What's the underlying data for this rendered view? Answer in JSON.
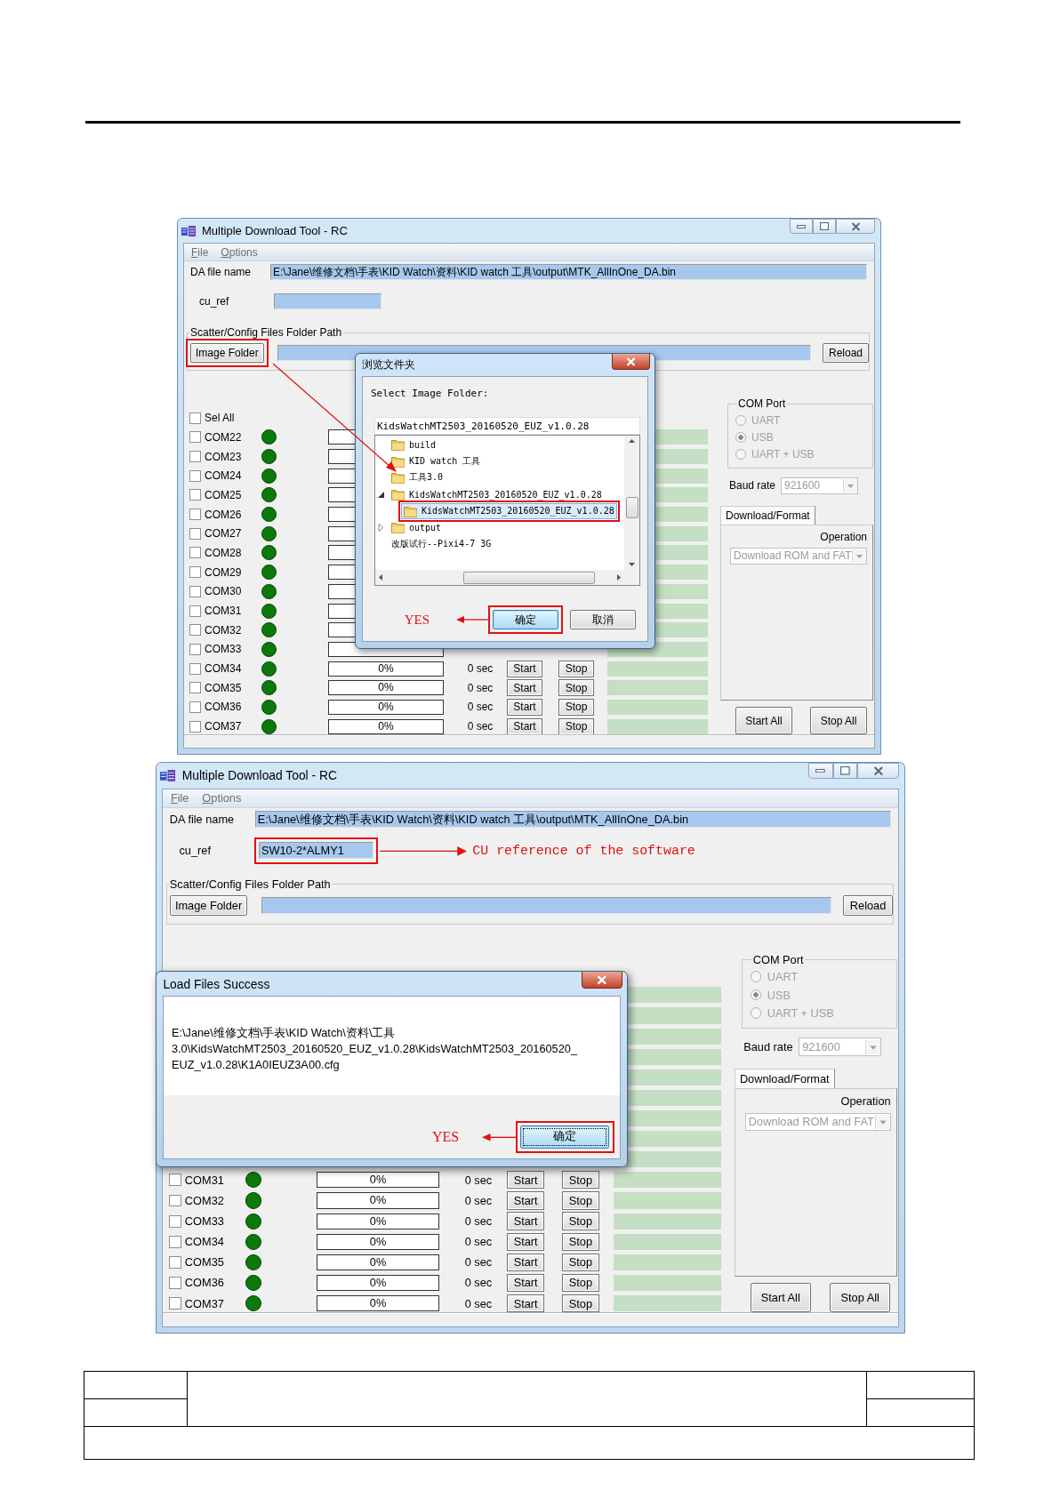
{
  "windows": [
    {
      "title": "Multiple Download Tool - RC",
      "menu": [
        "File",
        "Options"
      ],
      "da_file": {
        "label": "DA file name",
        "value": "E:\\Jane\\维修文档\\手表\\KID Watch\\资料\\KID watch 工具\\output\\MTK_AllInOne_DA.bin"
      },
      "cu_ref": {
        "label": "cu_ref",
        "highlighted": false
      },
      "scatter": {
        "legend": "Scatter/Config Files Folder Path",
        "button": "Image Folder",
        "button_highlighted": true,
        "reload": "Reload"
      },
      "pointer_line": true,
      "sel_all": {
        "label": "Sel All",
        "checked": false
      },
      "rows": [
        {
          "kind": "partial",
          "port": "COM22",
          "checked": false
        },
        {
          "kind": "partial",
          "port": "COM23",
          "checked": false
        },
        {
          "kind": "partial",
          "port": "COM24",
          "checked": false
        },
        {
          "kind": "partial",
          "port": "COM25",
          "checked": false
        },
        {
          "kind": "partial",
          "port": "COM26",
          "checked": false
        },
        {
          "kind": "partial",
          "port": "COM27",
          "checked": false
        },
        {
          "kind": "partial",
          "port": "COM28",
          "checked": false
        },
        {
          "kind": "partial",
          "port": "COM29",
          "checked": false
        },
        {
          "kind": "partial",
          "port": "COM30",
          "checked": false
        },
        {
          "kind": "partial",
          "port": "COM31",
          "checked": false
        },
        {
          "kind": "partial",
          "port": "COM32",
          "checked": false
        },
        {
          "kind": "partial",
          "port": "COM33",
          "checked": false
        },
        {
          "kind": "full",
          "port": "COM34",
          "checked": false,
          "progress": "0%",
          "time": "0 sec",
          "start": "Start",
          "stop": "Stop"
        },
        {
          "kind": "full",
          "port": "COM35",
          "checked": false,
          "progress": "0%",
          "time": "0 sec",
          "start": "Start",
          "stop": "Stop"
        },
        {
          "kind": "full",
          "port": "COM36",
          "checked": false,
          "progress": "0%",
          "time": "0 sec",
          "start": "Start",
          "stop": "Stop"
        },
        {
          "kind": "full",
          "port": "COM37",
          "checked": false,
          "progress": "0%",
          "time": "0 sec",
          "start": "Start",
          "stop": "Stop"
        }
      ],
      "com_port": {
        "legend": "COM Port",
        "options": [
          {
            "label": "UART",
            "selected": false
          },
          {
            "label": "USB",
            "selected": true
          },
          {
            "label": "UART + USB",
            "selected": false
          }
        ]
      },
      "baud_rate": {
        "label": "Baud rate",
        "value": "921600"
      },
      "tabs": [
        {
          "label": "Download/Format",
          "selected": true
        }
      ],
      "operation": {
        "label": "Operation",
        "value": "Download ROM and FAT"
      },
      "buttons": [
        "Start All",
        "Stop All"
      ],
      "dialog": {
        "kind": "folder_browser",
        "title": "浏览文件夹",
        "prompt": "Select Image Folder:",
        "path": "KidsWatchMT2503_20160520_EUZ_v1.0.28",
        "tree": [
          {
            "kind": "folder",
            "label": "build",
            "selected": false,
            "highlighted": false
          },
          {
            "kind": "folder",
            "label": "KID watch 工具",
            "selected": false,
            "highlighted": false
          },
          {
            "kind": "folder",
            "label": "工具3.0",
            "selected": false,
            "highlighted": false
          },
          {
            "kind": "folder",
            "label": "KidsWatchMT2503_20160520_EUZ_v1.0.28",
            "selected": false,
            "highlighted": false,
            "expanded": true,
            "children": [
              {
                "kind": "folder",
                "label": "KidsWatchMT2503_20160520_EUZ_v1.0.28",
                "selected": true,
                "highlighted": true
              }
            ]
          },
          {
            "kind": "folder",
            "label": "output",
            "selected": false,
            "highlighted": false,
            "expanded": false
          },
          {
            "kind": "text",
            "label": "改版试行--Pixi4-7 3G",
            "selected": false,
            "highlighted": false
          }
        ],
        "buttons": [
          {
            "label": "确定",
            "default": true,
            "highlighted": true
          },
          {
            "label": "取消",
            "default": false,
            "highlighted": false
          }
        ],
        "annotation": "YES"
      }
    },
    {
      "title": "Multiple Download Tool - RC",
      "menu": [
        "File",
        "Options"
      ],
      "da_file": {
        "label": "DA file name",
        "value": "E:\\Jane\\维修文档\\手表\\KID Watch\\资料\\KID watch 工具\\output\\MTK_AllInOne_DA.bin"
      },
      "cu_ref": {
        "label": "cu_ref",
        "value": "SW10-2*ALMY1",
        "highlighted": true,
        "callout": "CU reference of the software"
      },
      "scatter": {
        "legend": "Scatter/Config Files Folder Path",
        "button": "Image Folder",
        "button_highlighted": false,
        "reload": "Reload"
      },
      "rows": [
        {
          "kind": "covered"
        },
        {
          "kind": "covered"
        },
        {
          "kind": "covered"
        },
        {
          "kind": "covered"
        },
        {
          "kind": "covered"
        },
        {
          "kind": "covered"
        },
        {
          "kind": "covered"
        },
        {
          "kind": "covered"
        },
        {
          "kind": "covered"
        },
        {
          "kind": "full",
          "port": "COM31",
          "checked": false,
          "progress": "0%",
          "time": "0 sec",
          "start": "Start",
          "stop": "Stop"
        },
        {
          "kind": "full",
          "port": "COM32",
          "checked": false,
          "progress": "0%",
          "time": "0 sec",
          "start": "Start",
          "stop": "Stop"
        },
        {
          "kind": "full",
          "port": "COM33",
          "checked": false,
          "progress": "0%",
          "time": "0 sec",
          "start": "Start",
          "stop": "Stop"
        },
        {
          "kind": "full",
          "port": "COM34",
          "checked": false,
          "progress": "0%",
          "time": "0 sec",
          "start": "Start",
          "stop": "Stop"
        },
        {
          "kind": "full",
          "port": "COM35",
          "checked": false,
          "progress": "0%",
          "time": "0 sec",
          "start": "Start",
          "stop": "Stop"
        },
        {
          "kind": "full",
          "port": "COM36",
          "checked": false,
          "progress": "0%",
          "time": "0 sec",
          "start": "Start",
          "stop": "Stop"
        },
        {
          "kind": "full",
          "port": "COM37",
          "checked": false,
          "progress": "0%",
          "time": "0 sec",
          "start": "Start",
          "stop": "Stop"
        }
      ],
      "com_port": {
        "legend": "COM Port",
        "options": [
          {
            "label": "UART",
            "selected": false
          },
          {
            "label": "USB",
            "selected": true
          },
          {
            "label": "UART + USB",
            "selected": false
          }
        ]
      },
      "baud_rate": {
        "label": "Baud rate",
        "value": "921600"
      },
      "tabs": [
        {
          "label": "Download/Format",
          "selected": true
        }
      ],
      "operation": {
        "label": "Operation",
        "value": "Download ROM and FAT"
      },
      "buttons": [
        "Start All",
        "Stop All"
      ],
      "dialog": {
        "kind": "message",
        "title": "Load Files Success",
        "message": "E:\\Jane\\维修文档\\手表\\KID Watch\\资料\\工具 3.0\\KidsWatchMT2503_20160520_EUZ_v1.0.28\\KidsWatchMT2503_20160520_EUZ_v1.0.28\\K1A0IEUZ3A00.cfg",
        "buttons": [
          {
            "label": "确定",
            "default": true,
            "highlighted": true
          }
        ],
        "annotation": "YES"
      }
    }
  ]
}
